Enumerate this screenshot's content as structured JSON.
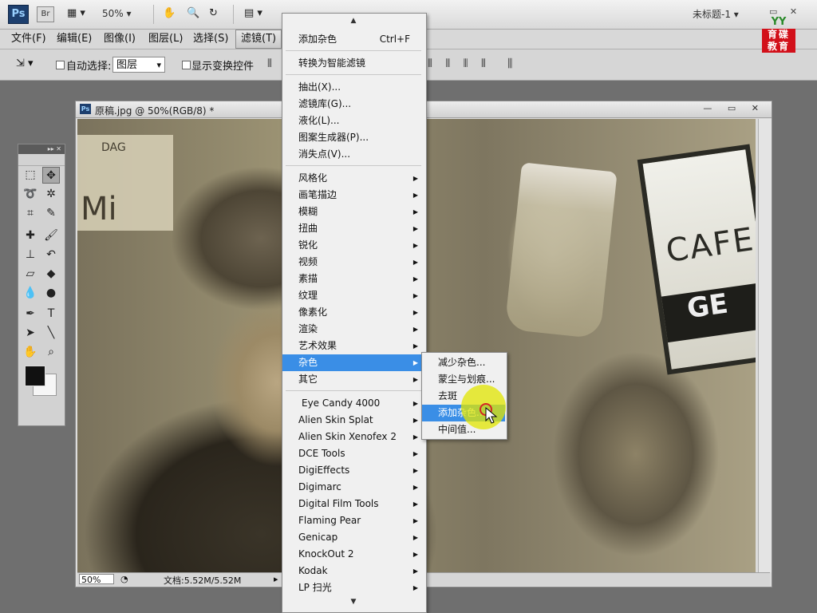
{
  "appbar": {
    "ps_logo": "Ps",
    "br_logo": "Br",
    "zoom": "50%",
    "doc_title": "未标题-1"
  },
  "watermark": {
    "top": "YY",
    "line1": "育碟",
    "line2": "教育"
  },
  "menubar": {
    "items": [
      "文件(F)",
      "编辑(E)",
      "图像(I)",
      "图层(L)",
      "选择(S)",
      "滤镜(T)"
    ]
  },
  "options": {
    "auto_select_label": "自动选择:",
    "layer_select_value": "图层",
    "show_transform_label": "显示变换控件"
  },
  "document": {
    "title": "原稿.jpg @ 50%(RGB/8) *",
    "status_zoom": "50%",
    "status_info": "文档:5.52M/5.52M",
    "sign_left_text": "Mi",
    "sign_text": "CAFE",
    "sign_text2": "GE",
    "sign_small": "DAG"
  },
  "filter_menu": {
    "top_arrow": "▲",
    "bottom_arrow": "▼",
    "last_filter": {
      "label": "添加杂色",
      "shortcut": "Ctrl+F"
    },
    "convert_smart": "转换为智能滤镜",
    "group1": [
      "抽出(X)...",
      "滤镜库(G)...",
      "液化(L)...",
      "图案生成器(P)...",
      "消失点(V)..."
    ],
    "group2": [
      "风格化",
      "画笔描边",
      "模糊",
      "扭曲",
      "锐化",
      "视频",
      "素描",
      "纹理",
      "像素化",
      "渲染",
      "艺术效果",
      "杂色",
      "其它"
    ],
    "plugins": [
      "Eye Candy 4000",
      "Alien Skin Splat",
      "Alien Skin Xenofex 2",
      "DCE Tools",
      "DigiEffects",
      "Digimarc",
      "Digital Film Tools",
      "Flaming Pear",
      "Genicap",
      "KnockOut 2",
      "Kodak",
      "LP 扫光"
    ],
    "highlighted": "杂色"
  },
  "noise_submenu": {
    "items": [
      "减少杂色...",
      "蒙尘与划痕...",
      "去斑",
      "添加杂色...",
      "中间值..."
    ],
    "highlighted": "添加杂色..."
  },
  "colors": {
    "menu_highlight": "#3a8ee6",
    "cursor_highlight": "#e2e600"
  }
}
